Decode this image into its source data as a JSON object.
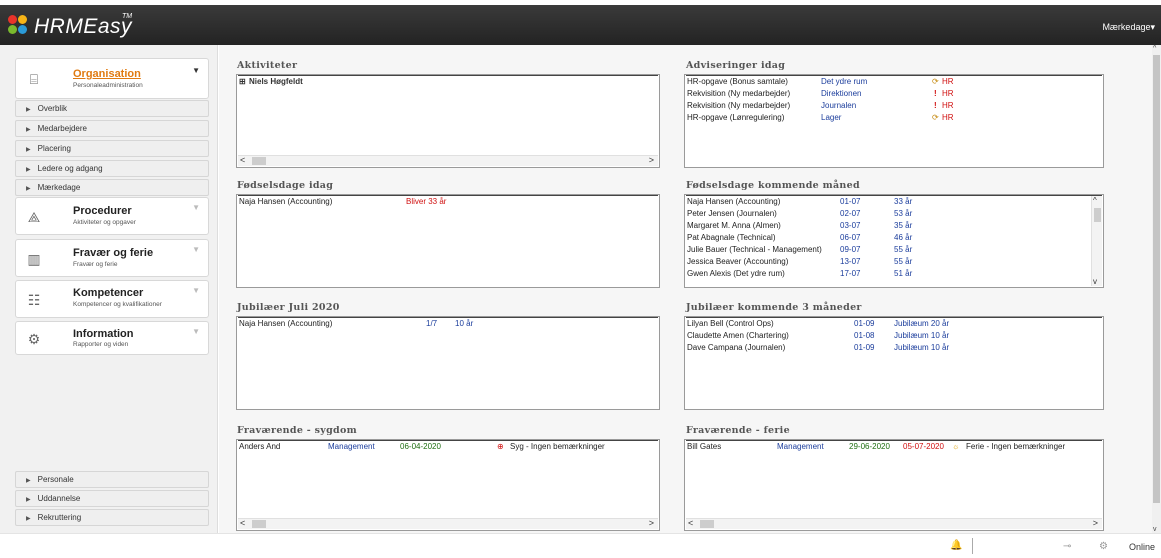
{
  "app": {
    "name": "HRMEasy",
    "trademark": "TM",
    "top_right_label": "Mærkedage",
    "top_right_chevron": "▾"
  },
  "colors": {
    "accent": "#e07a10",
    "link_blue": "#1b3d9c",
    "alert_red": "#d01010",
    "date_green": "#1f6e12"
  },
  "sidebar": {
    "modules": [
      {
        "id": "organisation",
        "title": "Organisation",
        "subtitle": "Personaleadministration",
        "icon": "building-icon",
        "glyph": "⌸",
        "chevron": "▼",
        "active": true
      },
      {
        "id": "procedurer",
        "title": "Procedurer",
        "subtitle": "Aktiviteter og opgaver",
        "icon": "network-icon",
        "glyph": "⟁",
        "chevron": "▼"
      },
      {
        "id": "fravaer",
        "title": "Fravær og ferie",
        "subtitle": "Fravær og ferie",
        "icon": "bar-chart-icon",
        "glyph": "▥",
        "chevron": "▼"
      },
      {
        "id": "kompetencer",
        "title": "Kompetencer",
        "subtitle": "Kompetencer og kvalifikationer",
        "icon": "certificate-icon",
        "glyph": "☷",
        "chevron": "▼"
      },
      {
        "id": "information",
        "title": "Information",
        "subtitle": "Rapporter og viden",
        "icon": "gear-icon",
        "glyph": "⚙",
        "chevron": "▼"
      }
    ],
    "org_items": [
      "Overblik",
      "Medarbejdere",
      "Placering",
      "Ledere og adgang",
      "Mærkedage"
    ],
    "bottom_items": [
      "Personale",
      "Uddannelse",
      "Rekruttering"
    ],
    "arrow_glyph": "▶"
  },
  "panels": {
    "aktiviteter": {
      "title": "Aktiviteter",
      "rows": [
        {
          "name": "Niels Høgfeldt",
          "expander": "⊞"
        }
      ]
    },
    "adviseringer": {
      "title": "Adviseringer idag",
      "rows": [
        {
          "task": "HR-opgave (Bonus samtale)",
          "dept": "Det ydre rum",
          "icon": "⟳",
          "tag": "HR"
        },
        {
          "task": "Rekvisition (Ny medarbejder)",
          "dept": "Direktionen",
          "icon": "!",
          "tag": "HR"
        },
        {
          "task": "Rekvisition (Ny medarbejder)",
          "dept": "Journalen",
          "icon": "!",
          "tag": "HR"
        },
        {
          "task": "HR-opgave (Lønregulering)",
          "dept": "Lager",
          "icon": "⟳",
          "tag": "HR"
        }
      ]
    },
    "fodselsdage_idag": {
      "title": "Fødselsdage idag",
      "rows": [
        {
          "name": "Naja Hansen (Accounting)",
          "note": "Bliver 33 år"
        }
      ]
    },
    "fodselsdage_maaned": {
      "title": "Fødselsdage kommende måned",
      "rows": [
        {
          "name": "Naja Hansen (Accounting)",
          "date": "01-07",
          "age": "33 år"
        },
        {
          "name": "Peter Jensen (Journalen)",
          "date": "02-07",
          "age": "53 år"
        },
        {
          "name": "Margaret M. Anna (Almen)",
          "date": "03-07",
          "age": "35 år"
        },
        {
          "name": "Pat Abagnale (Technical)",
          "date": "06-07",
          "age": "46 år"
        },
        {
          "name": "Julie Bauer (Technical - Management)",
          "date": "09-07",
          "age": "55 år"
        },
        {
          "name": "Jessica Beaver (Accounting)",
          "date": "13-07",
          "age": "55 år"
        },
        {
          "name": "Gwen Alexis (Det ydre rum)",
          "date": "17-07",
          "age": "51 år"
        }
      ]
    },
    "jubilaeer_juli": {
      "title": "Jubilæer Juli 2020",
      "rows": [
        {
          "name": "Naja Hansen (Accounting)",
          "date": "1/7",
          "years": "10 år"
        }
      ]
    },
    "jubilaeer_3m": {
      "title": "Jubilæer kommende 3 måneder",
      "rows": [
        {
          "name": "Lilyan Bell (Control Ops)",
          "date": "01-09",
          "label": "Jubilæum 20 år"
        },
        {
          "name": "Claudette Amen (Chartering)",
          "date": "01-08",
          "label": "Jubilæum 10 år"
        },
        {
          "name": "Dave Campana (Journalen)",
          "date": "01-09",
          "label": "Jubilæum 10 år"
        }
      ]
    },
    "sygdom": {
      "title": "Fraværende - sygdom",
      "rows": [
        {
          "name": "Anders And",
          "dept": "Management",
          "from": "06-04-2020",
          "icon": "⊕",
          "status": "Syg  - Ingen bemærkninger"
        }
      ]
    },
    "ferie": {
      "title": "Fraværende - ferie",
      "rows": [
        {
          "name": "Bill Gates",
          "dept": "Management",
          "from": "29-06-2020",
          "to": "05-07-2020",
          "icon": "☼",
          "status": "Ferie - Ingen bemærkninger"
        }
      ]
    }
  },
  "scroll": {
    "left": "<",
    "right": ">",
    "up": "^",
    "down": "v"
  },
  "statusbar": {
    "online": "Online",
    "bell_glyph": "🔔",
    "toggle_glyph": "⊸",
    "network_glyph": "⚙"
  }
}
